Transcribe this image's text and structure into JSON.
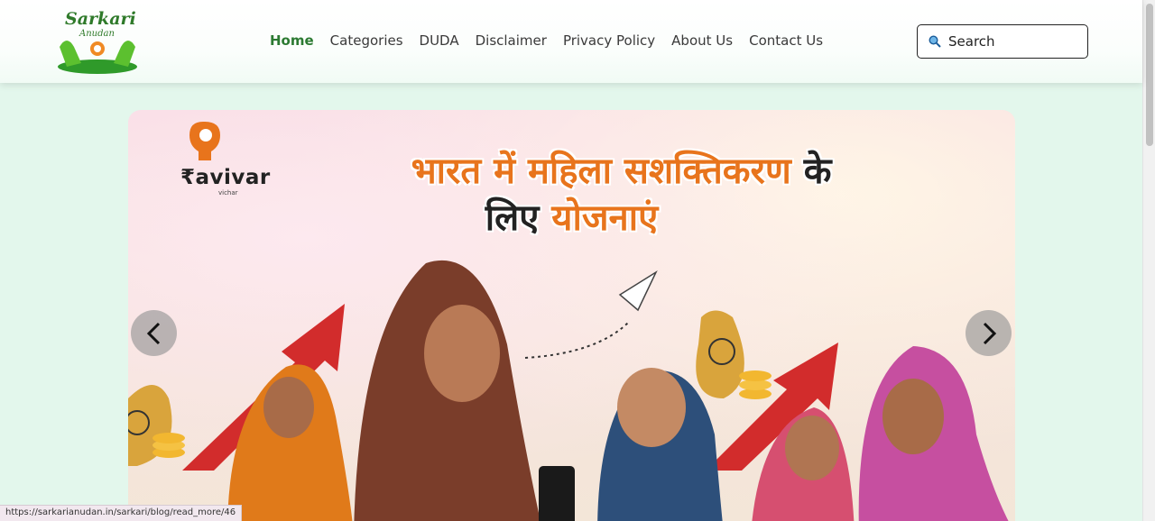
{
  "header": {
    "logo": {
      "line1": "Sarkari",
      "line2": "Anudan"
    },
    "nav": [
      {
        "label": "Home",
        "active": true
      },
      {
        "label": "Categories",
        "active": false
      },
      {
        "label": "DUDA",
        "active": false
      },
      {
        "label": "Disclaimer",
        "active": false
      },
      {
        "label": "Privacy Policy",
        "active": false
      },
      {
        "label": "About Us",
        "active": false
      },
      {
        "label": "Contact Us",
        "active": false
      }
    ],
    "search": {
      "placeholder": "Search",
      "icon": "search-icon"
    }
  },
  "banner": {
    "brand": {
      "name": "₹avivar",
      "sub": "vichar"
    },
    "headline": {
      "line1_part1": "भारत में ",
      "line1_part2": "महिला सशक्तिकरण ",
      "line1_part3": "के",
      "line2_part1": "लिए ",
      "line2_part2": "योजनाएं"
    },
    "prev_icon": "chevron-left-icon",
    "next_icon": "chevron-right-icon"
  },
  "status_bar": {
    "url": "https://sarkarianudan.in/sarkari/blog/read_more/46"
  },
  "colors": {
    "accent": "#2c7a32",
    "headline_orange": "#e8741c",
    "page_bg": "#e3f7ec"
  }
}
